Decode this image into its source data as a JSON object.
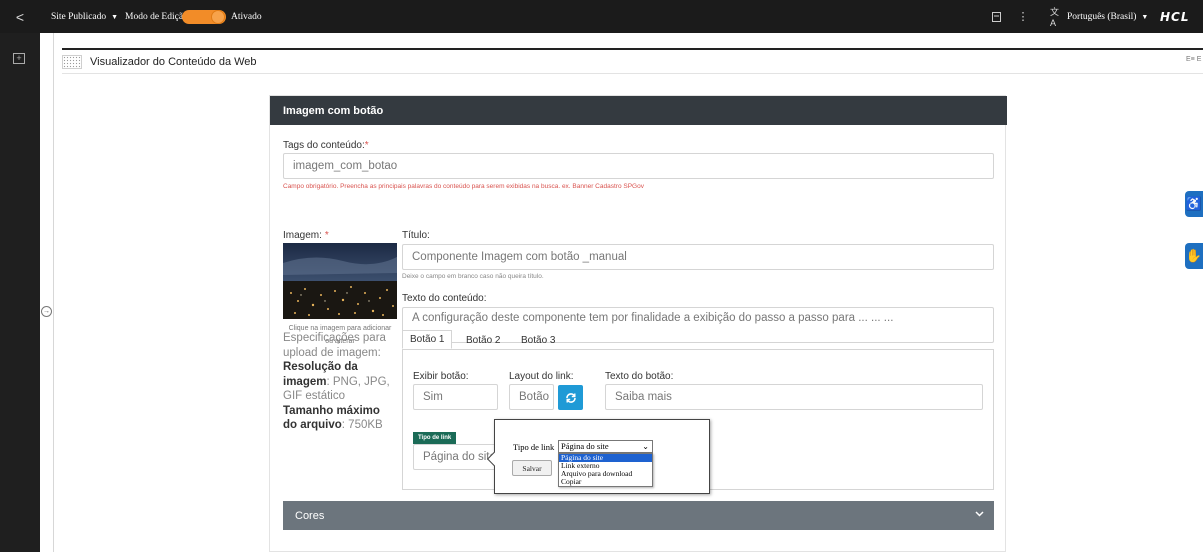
{
  "topbar": {
    "back": "<",
    "site_status": "Site Publicado",
    "edit_mode_label": "Modo de Edição:",
    "edit_mode_state": "Ativado",
    "language": "Português (Brasil)",
    "brand": "HCL"
  },
  "portlet": {
    "title": "Visualizador do Conteúdo da Web",
    "right_mini": "E≡ E"
  },
  "card": {
    "title": "Imagem com botão",
    "tags": {
      "label": "Tags do conteúdo:",
      "required": "*",
      "value": "imagem_com_botao",
      "hint": "Campo obrigatório. Preencha as principais palavras do conteúdo para serem exibidas na busca. ex. Banner Cadastro SPGov"
    },
    "image": {
      "label": "Imagem:",
      "required": "*",
      "caption_line1": "Clique na imagem para adicionar",
      "caption_line2": "ou alterar"
    },
    "title_field": {
      "label": "Título:",
      "value": "Componente Imagem com botão _manual",
      "hint": "Deixe o campo em branco caso não queira título."
    },
    "content_text": {
      "label": "Texto do conteúdo:",
      "value": "A configuração deste componente tem por finalidade a exibição do passo a passo para ... ... ..."
    },
    "spec": {
      "intro": "Especificações para upload de imagem:",
      "resolution_label": "Resolução da imagem",
      "resolution_value": ": PNG, JPG, GIF estático",
      "size_label": "Tamanho máximo do arquivo",
      "size_value": ": 750KB"
    },
    "tabs": [
      "Botão 1",
      "Botão 2",
      "Botão 3"
    ],
    "button_panel": {
      "show_label": "Exibir botão:",
      "show_value": "Sim",
      "layout_label": "Layout do link:",
      "layout_value": "Botão",
      "text_label": "Texto do botão:",
      "text_value": "Saiba mais",
      "link_type_badge": "Tipo de link",
      "link_type_value": "Página do site"
    },
    "popup": {
      "label": "Tipo de link",
      "selected": "Página do site",
      "save": "Salvar",
      "options": [
        "Página do site",
        "Link externo",
        "Arquivo para download",
        "Copiar"
      ]
    },
    "colors_section": "Cores"
  },
  "colors": {
    "accent": "#f28c28",
    "card_header": "#343a40",
    "section_header": "#6c757d",
    "action_button": "#1f9ad6",
    "badge": "#1b6b57",
    "selection": "#1e62d0"
  },
  "icons": {
    "refresh": "refresh-icon",
    "chevron": "chevron-down-icon",
    "accessibility": "accessibility-icon",
    "sign_language": "sign-language-icon"
  }
}
